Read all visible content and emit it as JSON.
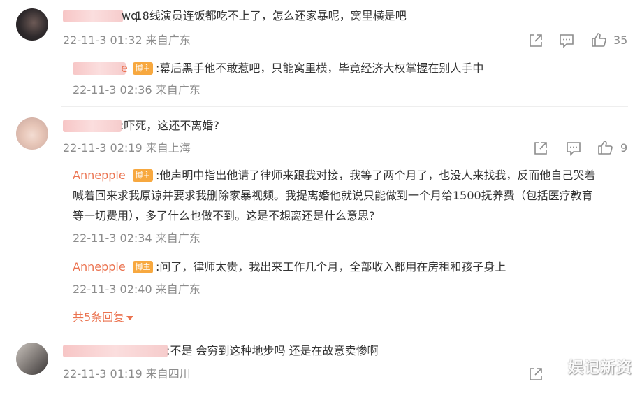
{
  "comments": [
    {
      "username_tail": "wq",
      "text": ":18线演员连饭都吃不上了，怎么还家暴呢，窝里横是吧",
      "time": "22-11-3 01:32 来自广东",
      "likes": "35",
      "replies": [
        {
          "username": "e",
          "badge": "博主",
          "text": ":幕后黑手他不敢惹吧，只能窝里横，毕竟经济大权掌握在别人手中",
          "time": "22-11-3 02:36 来自广东"
        }
      ]
    },
    {
      "username_tail": "",
      "text": ":吓死，这还不离婚?",
      "time": "22-11-3 02:19 来自上海",
      "likes": "9",
      "replies": [
        {
          "username": "Annepple",
          "badge": "博主",
          "text_line1": ":他声明中指出他请了律师来跟我对接，我等了两个月了，也没人来找我，反而他自己哭着",
          "text_line2": "喊着回来求我原谅并要求我删除家暴视频。我提离婚他就说只能做到一个月给1500抚养费（包括医疗教育",
          "text_line3": "等一切费用），多了什么也做不到。这是不想离还是什么意思?",
          "time": "22-11-3 02:34 来自广东"
        },
        {
          "username": "Annepple",
          "badge": "博主",
          "text": ":问了，律师太贵，我出来工作几个月，全部收入都用在房租和孩子身上",
          "time": "22-11-3 02:40 来自广东"
        }
      ],
      "more_replies": "共5条回复"
    },
    {
      "username_tail": "",
      "text": ":不是 会穷到这种地步吗 还是在故意卖惨啊",
      "time": "22-11-3 01:19 来自四川"
    }
  ],
  "icons": {
    "share": "share-icon",
    "comment": "comment-icon",
    "like": "thumbs-up-icon"
  },
  "colors": {
    "accent": "#eb7350",
    "badge": "#f7a83f",
    "meta": "#8c8c8c"
  },
  "watermark": "娱记新资"
}
